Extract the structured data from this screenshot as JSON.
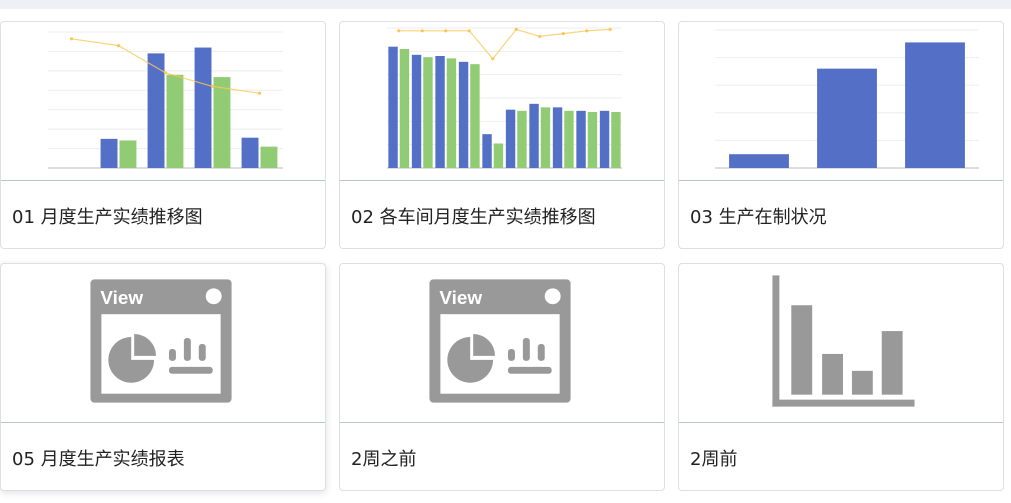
{
  "colors": {
    "series_blue": "#5470c6",
    "series_green": "#91cc75",
    "line_orange": "#fac858",
    "icon_gray": "#999999"
  },
  "cards": [
    {
      "title": "01 月度生产实绩推移图",
      "thumbnail": "chart",
      "chart_data": {
        "type": "bar",
        "categories": [
          "",
          "",
          "",
          "",
          ""
        ],
        "series": [
          {
            "values": [
              0,
              750,
              2950,
              3100,
              780
            ]
          },
          {
            "values": [
              0,
              710,
              2400,
              2340,
              550
            ]
          },
          {
            "type": "line",
            "axis": "right",
            "values": [
              95,
              90,
              70,
              60,
              55
            ]
          }
        ],
        "ylim": [
          0,
          3500
        ],
        "y2lim": [
          0,
          100
        ]
      }
    },
    {
      "title": "02 各车间月度生产实绩推移图",
      "thumbnail": "chart",
      "chart_data": {
        "type": "bar",
        "categories": [
          "",
          "",
          "",
          "",
          "",
          "",
          "",
          "",
          "",
          ""
        ],
        "series": [
          {
            "values": [
              10400,
              9700,
              9600,
              9100,
              2900,
              5000,
              5500,
              5200,
              4900,
              4900
            ]
          },
          {
            "values": [
              10200,
              9500,
              9400,
              8900,
              2100,
              4900,
              5200,
              4900,
              4800,
              4800
            ]
          },
          {
            "type": "line",
            "axis": "right",
            "values": [
              98,
              98,
              98,
              98,
              78,
              99,
              94,
              96,
              98,
              99
            ]
          }
        ],
        "ylim": [
          0,
          12000
        ],
        "y2lim": [
          0,
          100
        ]
      }
    },
    {
      "title": "03 生产在制状况",
      "thumbnail": "chart",
      "chart_data": {
        "type": "bar",
        "categories": [
          "",
          "",
          ""
        ],
        "series": [
          {
            "values": [
              500,
              3600,
              4550
            ]
          }
        ],
        "ylim": [
          0,
          5000
        ]
      }
    },
    {
      "title": "05 月度生产实绩报表",
      "thumbnail": "view-icon",
      "icon_label": "View"
    },
    {
      "title": "2周之前",
      "thumbnail": "view-icon",
      "icon_label": "View"
    },
    {
      "title": "2周前",
      "thumbnail": "bar-chart-icon"
    }
  ]
}
